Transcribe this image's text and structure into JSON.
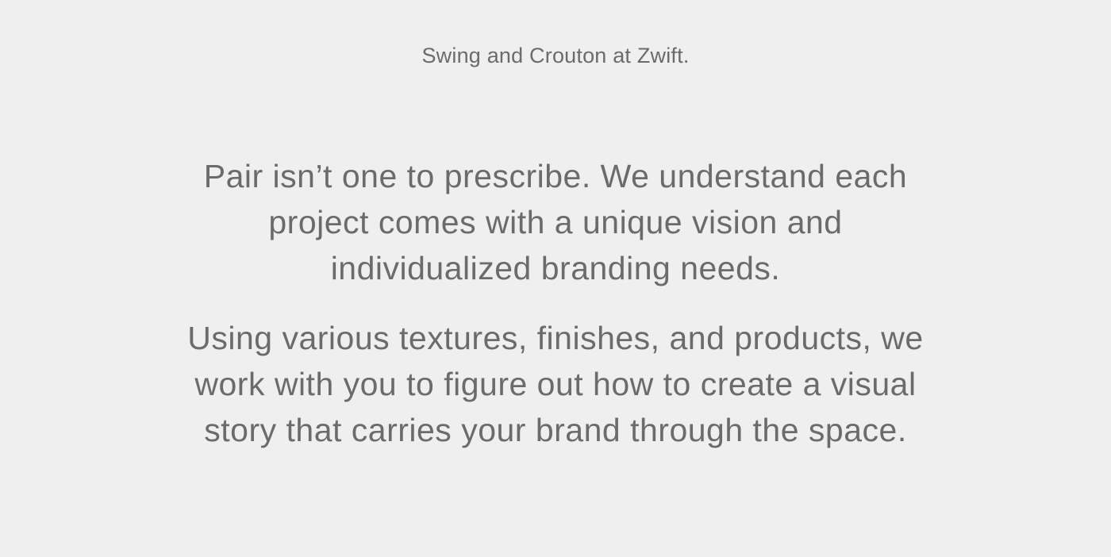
{
  "caption": "Swing and Crouton at Zwift.",
  "paragraphs": [
    {
      "lines": [
        "Pair isn’t one to prescribe. We understand each",
        "project comes with a unique vision and",
        "individualized branding needs."
      ]
    },
    {
      "lines": [
        "Using various textures, finishes, and products, we",
        "work with you to figure out how to create a visual",
        "story that carries your brand through the space."
      ]
    }
  ],
  "colors": {
    "background": "#efefef",
    "text": "#6b6b6b"
  }
}
